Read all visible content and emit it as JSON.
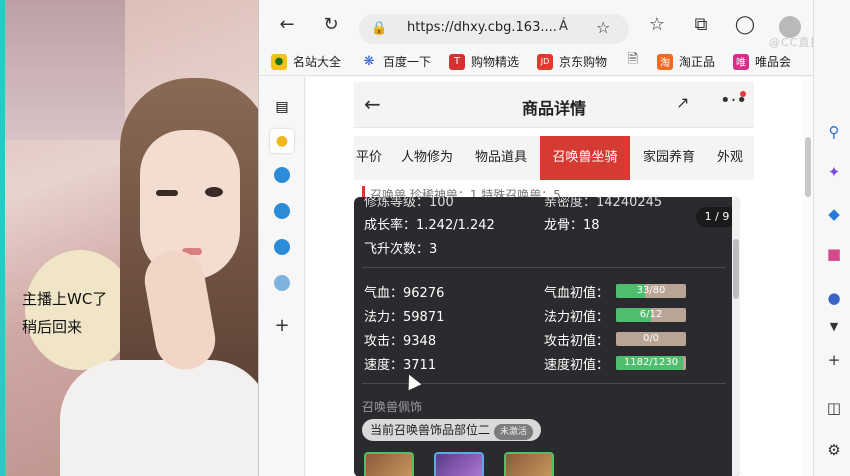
{
  "stream": {
    "caption_line1": "主播上WC了",
    "caption_line2": "稍后回来"
  },
  "browser": {
    "url": "https://dhxy.cbg.163....",
    "read_aloud": "Á",
    "watermark": "@CC直播",
    "bookmarks": [
      {
        "label": "名站大全",
        "color": "#2f9b2f",
        "icon": "globe-icon"
      },
      {
        "label": "百度一下",
        "color": "#2f5fd6",
        "icon": "paw-icon"
      },
      {
        "label": "购物精选",
        "color": "#d43131",
        "icon": "T"
      },
      {
        "label": "京东购物",
        "color": "#e03a2f",
        "icon": "JD"
      },
      {
        "label": "淘正品",
        "color": "#f06a22",
        "icon": "淘"
      },
      {
        "label": "唯品会",
        "color": "#d62f8a",
        "icon": "唯"
      }
    ]
  },
  "page": {
    "title": "商品详情",
    "tabs": [
      "平价",
      "人物修为",
      "物品道具",
      "召唤兽坐骑",
      "家园养育",
      "外观"
    ],
    "active_tab": "召唤兽坐骑",
    "peek_text": "召唤兽   珍稀神兽：1   特殊召唤兽：5"
  },
  "tooltip": {
    "pager": "1 / 9",
    "top_left": "修炼等级：100",
    "top_right": "亲密度：14240245",
    "growth": "成长率：1.242/1.242",
    "bone": "龙骨：18",
    "ascend": "飞升次数：3",
    "stats": [
      {
        "name": "气血：96276",
        "init_label": "气血初值：",
        "init_value": "33/80",
        "fraction": 0.41
      },
      {
        "name": "法力：59871",
        "init_label": "法力初值：",
        "init_value": "6/12",
        "fraction": 0.5
      },
      {
        "name": "攻击：9348",
        "init_label": "攻击初值：",
        "init_value": "0/0",
        "fraction": 0
      },
      {
        "name": "速度：3711",
        "init_label": "速度初值：",
        "init_value": "1182/1230",
        "fraction": 0.96
      }
    ],
    "section_title": "召唤兽佩饰",
    "pill_text": "当前召唤兽饰品部位二",
    "pill_tag": "未激活"
  }
}
